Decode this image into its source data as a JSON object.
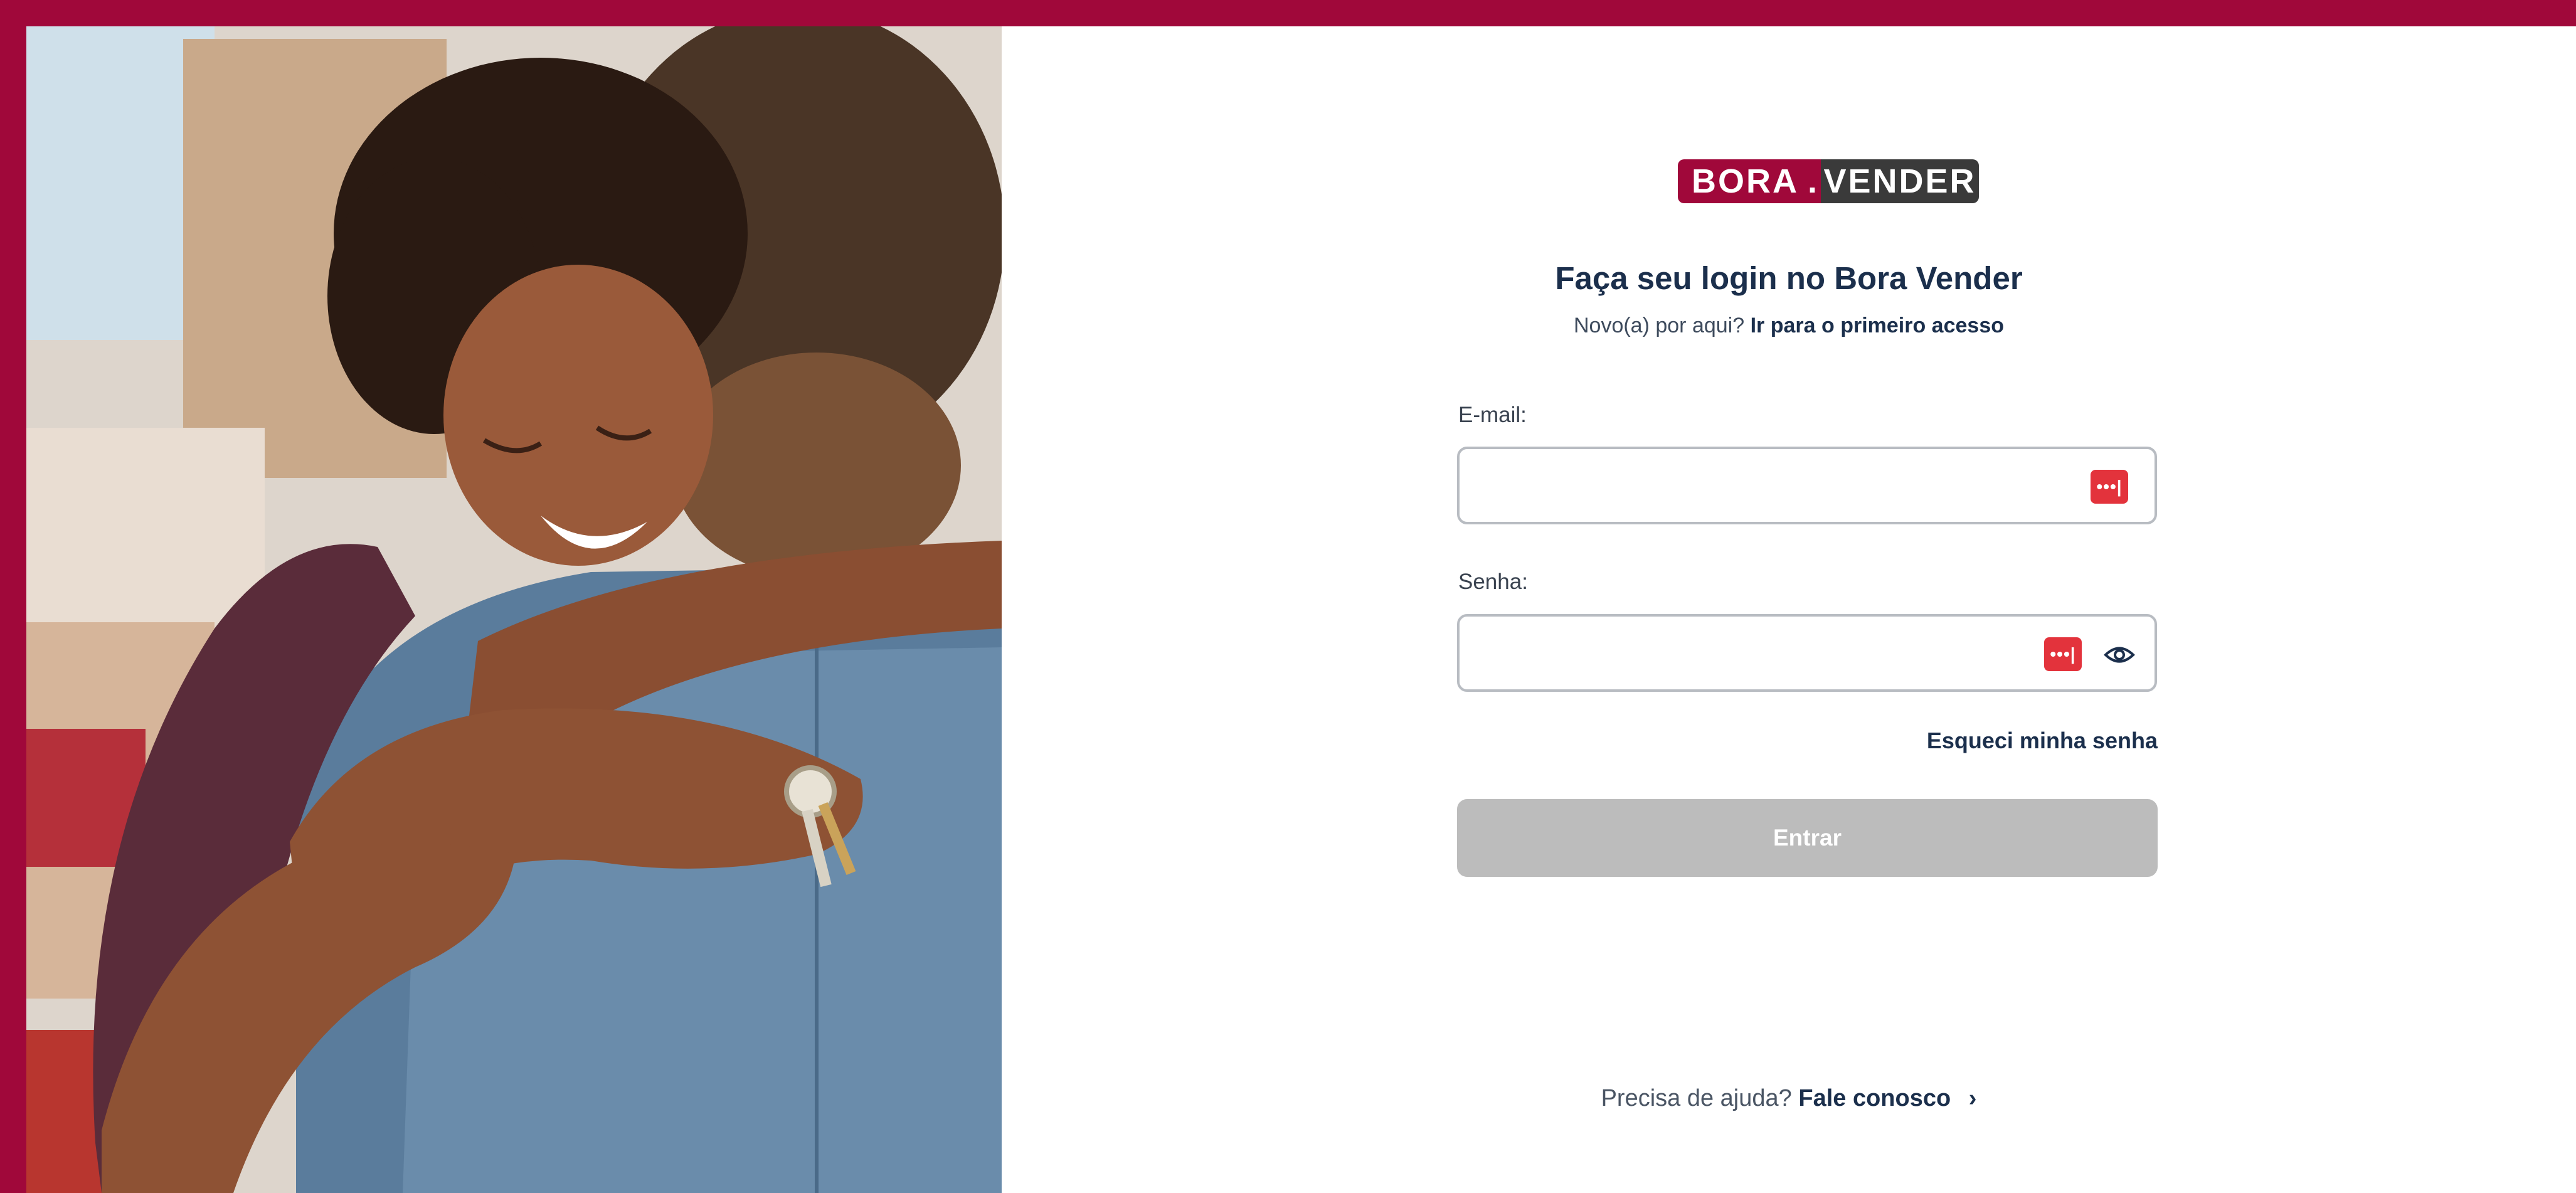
{
  "logo": {
    "left": "BORA",
    "dot": ".",
    "right": "VENDER"
  },
  "login": {
    "title": "Faça seu login no Bora Vender",
    "subtitle_text": "Novo(a) por aqui?",
    "subtitle_link": "Ir para o primeiro acesso",
    "email_label": "E-mail:",
    "email_value": "",
    "password_label": "Senha:",
    "password_value": "",
    "forgot_link": "Esqueci minha senha",
    "submit_label": "Entrar"
  },
  "footer": {
    "help_text": "Precisa de ajuda?",
    "help_link": "Fale conosco",
    "chevron": "›"
  },
  "password_manager_glyph": "•••|",
  "colors": {
    "brand": "#a0083a",
    "heading": "#1b2f4c",
    "button_disabled": "#bcbcbc",
    "manager_icon": "#e3333c"
  },
  "icons": [
    "password-manager-icon",
    "eye-icon",
    "chevron-right-icon"
  ]
}
